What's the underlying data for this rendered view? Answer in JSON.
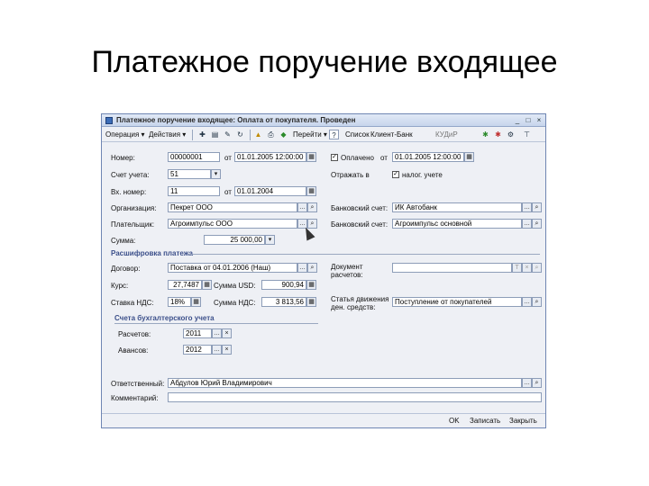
{
  "slide_title": "Платежное поручение входящее",
  "window": {
    "title": "Платежное поручение входящее: Оплата от покупателя. Проведен",
    "controls": [
      "_",
      "□",
      "×"
    ]
  },
  "toolbar": {
    "operation": "Операция ▾",
    "actions": "Действия ▾",
    "goto": "Перейти ▾",
    "help": "?",
    "list": "Список",
    "client_bank": "Клиент-Банк",
    "kudir": "КУДиР"
  },
  "form": {
    "number_label": "Номер:",
    "number_value": "00000001",
    "from1": "от",
    "date1": "01.01.2005 12:00:00",
    "account_label": "Счет учета:",
    "account_value": "51",
    "paid_label": "Оплачено",
    "paid_from": "от",
    "date_paid": "01.01.2005 12:00:00",
    "incoming_no_label": "Вх. номер:",
    "incoming_no_value": "11",
    "from2": "от",
    "date_incoming": "01.01.2004",
    "tax_label": "Отражать в",
    "tax_value": "налог. учете",
    "org_label": "Организация:",
    "org_value": "Пекрет ООО",
    "bank_account_label": "Банковский счет:",
    "bank_account_value": "ИК Автобанк",
    "payer_label": "Плательщик:",
    "payer_value": "Агроимпульс ООО",
    "payer_bank_label": "Банковский счет:",
    "payer_bank_value": "Агроимпульс основной",
    "sum_label": "Сумма:",
    "sum_value": "25 000,00",
    "details_section": "Расшифровка платежа",
    "contract_label": "Договор:",
    "contract_value": "Поставка от 04.01.2006 (Наш)",
    "settlement_doc_label": "Документ",
    "settlement_doc_label2": "расчетов:",
    "rate_label": "Курс:",
    "rate_value": "27,7487",
    "sum_usd_label": "Сумма USD:",
    "sum_usd_value": "900,94",
    "cash_flow_label": "Статья движения",
    "cash_flow_label2": "ден. средств:",
    "cash_flow_value": "Поступление от покупателей",
    "vat_rate_label": "Ставка НДС:",
    "vat_rate_value": "18%",
    "vat_sum_label": "Сумма НДС:",
    "vat_sum_value": "3 813,56",
    "accounts_section": "Счета бухгалтерского учета",
    "settlements_label": "Расчетов:",
    "settlements_value": "2011",
    "advances_label": "Авансов:",
    "advances_value": "2012",
    "responsible_label": "Ответственный:",
    "responsible_value": "Абдулов Юрий Владимирович",
    "comment_label": "Комментарий:",
    "comment_value": ""
  },
  "status": {
    "ok": "OK",
    "save": "Записать",
    "close": "Закрыть"
  }
}
